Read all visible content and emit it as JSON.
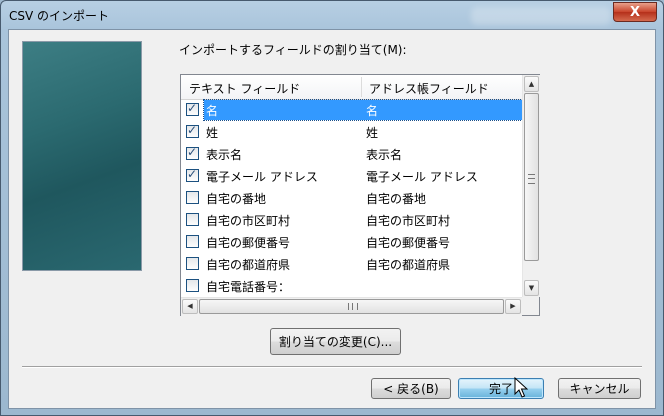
{
  "window": {
    "title": "CSV のインポート",
    "close_glyph": "X"
  },
  "assign_label": "インポートするフィールドの割り当て(M):",
  "list": {
    "columns": [
      "テキスト フィールド",
      "アドレス帳フィールド"
    ],
    "rows": [
      {
        "text": "名",
        "mapped": "名",
        "checked": true,
        "selected": true
      },
      {
        "text": "姓",
        "mapped": "姓",
        "checked": true,
        "selected": false
      },
      {
        "text": "表示名",
        "mapped": "表示名",
        "checked": true,
        "selected": false
      },
      {
        "text": "電子メール アドレス",
        "mapped": "電子メール アドレス",
        "checked": true,
        "selected": false
      },
      {
        "text": "自宅の番地",
        "mapped": "自宅の番地",
        "checked": false,
        "selected": false
      },
      {
        "text": "自宅の市区町村",
        "mapped": "自宅の市区町村",
        "checked": false,
        "selected": false
      },
      {
        "text": "自宅の郵便番号",
        "mapped": "自宅の郵便番号",
        "checked": false,
        "selected": false
      },
      {
        "text": "自宅の都道府県",
        "mapped": "自宅の都道府県",
        "checked": false,
        "selected": false
      },
      {
        "text": "自宅電話番号：",
        "mapped": "",
        "checked": false,
        "selected": false
      }
    ]
  },
  "buttons": {
    "change_mapping": "割り当ての変更(C)...",
    "back": "< 戻る(B)",
    "finish": "完了",
    "cancel": "キャンセル"
  },
  "icons": {
    "close": "close-icon",
    "checkbox": "checkbox-icon",
    "scroll_up": "arrow-up-icon",
    "scroll_down": "arrow-down-icon",
    "scroll_left": "arrow-left-icon",
    "scroll_right": "arrow-right-icon",
    "cursor": "mouse-pointer-icon"
  },
  "colors": {
    "selection": "#3399ff",
    "default_button": "#98d1ef",
    "banner": "#2b6a70"
  }
}
